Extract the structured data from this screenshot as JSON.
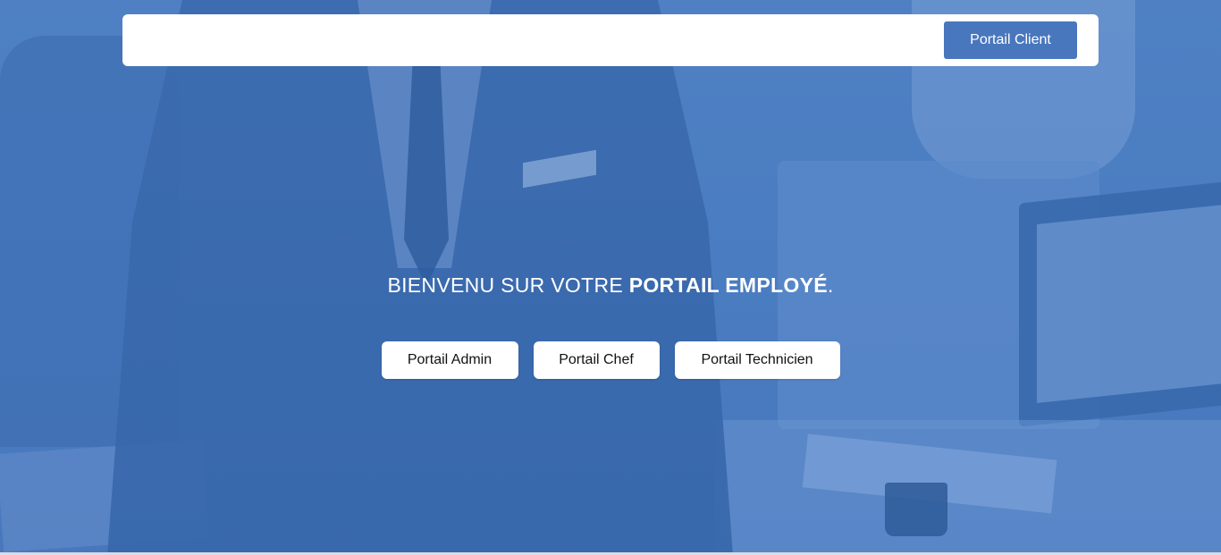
{
  "navbar": {
    "client_button_label": "Portail Client"
  },
  "hero": {
    "headline_prefix": "BIENVENU SUR VOTRE ",
    "headline_emphasis": "PORTAIL EMPLOYÉ",
    "headline_suffix": "."
  },
  "portals": [
    {
      "label": "Portail Admin"
    },
    {
      "label": "Portail Chef"
    },
    {
      "label": "Portail Technicien"
    }
  ],
  "colors": {
    "overlay_blue": "#4a7cc1",
    "accent_button": "#4877bd",
    "navbar_bg": "#ffffff",
    "text_light": "#ffffff"
  }
}
